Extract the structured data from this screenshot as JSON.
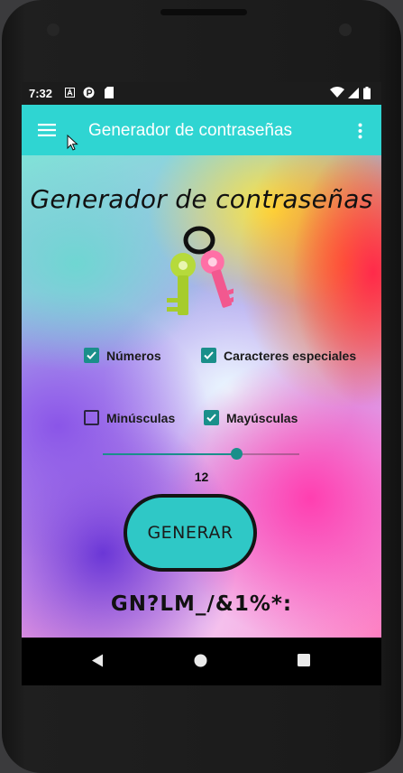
{
  "status_bar": {
    "time": "7:32",
    "icons": [
      "a-notification-icon",
      "p-notification-icon",
      "sd-card-icon",
      "wifi-icon",
      "signal-icon",
      "battery-icon"
    ]
  },
  "app_bar": {
    "title": "Generador de contraseñas",
    "menu_icon": "hamburger-menu-icon",
    "overflow_icon": "more-vert-icon"
  },
  "main": {
    "heading": "Generador de contraseñas",
    "logo_icon": "keys-icon",
    "options": [
      {
        "label": "Números",
        "checked": true
      },
      {
        "label": "Caracteres especiales",
        "checked": true
      },
      {
        "label": "Minúsculas",
        "checked": false
      },
      {
        "label": "Mayúsculas",
        "checked": true
      }
    ],
    "length_slider": {
      "value": "12",
      "fraction": 0.68
    },
    "generate_button": "GENERAR",
    "generated_password": "GN?LM_/&1%*:"
  },
  "colors": {
    "accent": "#2fd5d2",
    "checkbox": "#1a8f8a",
    "status_bar": "#1c1c1c"
  },
  "nav_bar": {
    "icons": [
      "back-icon",
      "home-icon",
      "recents-icon"
    ]
  }
}
